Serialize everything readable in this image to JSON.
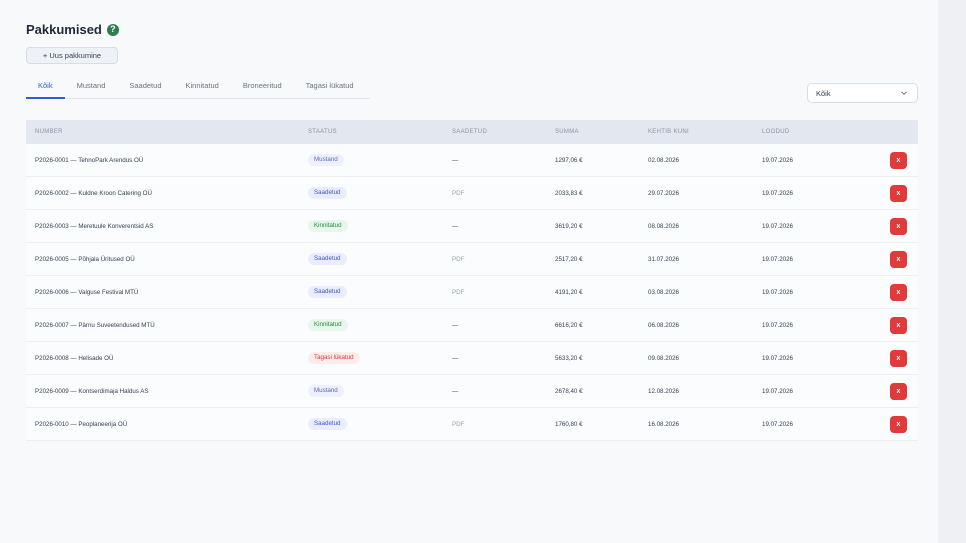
{
  "header": {
    "title": "Pakkumised",
    "help_glyph": "?",
    "new_button_label": "+ Uus pakkumine"
  },
  "tabs": [
    {
      "label": "Kõik",
      "active": true
    },
    {
      "label": "Mustand",
      "active": false
    },
    {
      "label": "Saadetud",
      "active": false
    },
    {
      "label": "Kinnitatud",
      "active": false
    },
    {
      "label": "Broneeritud",
      "active": false
    },
    {
      "label": "Tagasi lükatud",
      "active": false
    }
  ],
  "filter": {
    "selected": "Kõik"
  },
  "table": {
    "columns": [
      "NUMBER",
      "STAATUS",
      "SAADETUD",
      "SUMMA",
      "KEHTIB KUNI",
      "LOODUD"
    ],
    "delete_label": "x",
    "rows": [
      {
        "number": "P2026-0001 — TehnoPark Arendus OÜ",
        "status": "Mustand",
        "status_type": "draft",
        "sent": "—",
        "sum": "1297,06 €",
        "valid_until": "02.08.2026",
        "created": "19.07.2026"
      },
      {
        "number": "P2026-0002 — Kuldne Kroon Catering OÜ",
        "status": "Saadetud",
        "status_type": "sent",
        "sent": "PDF",
        "sum": "2033,83 €",
        "valid_until": "29.07.2026",
        "created": "19.07.2026"
      },
      {
        "number": "P2026-0003 — Meretuule Konverentsid AS",
        "status": "Kinnitatud",
        "status_type": "confirmed",
        "sent": "—",
        "sum": "3619,20 €",
        "valid_until": "08.08.2026",
        "created": "19.07.2026"
      },
      {
        "number": "P2026-0005 — Põhjala Üritused OÜ",
        "status": "Saadetud",
        "status_type": "sent",
        "sent": "PDF",
        "sum": "2517,20 €",
        "valid_until": "31.07.2026",
        "created": "19.07.2026"
      },
      {
        "number": "P2026-0006 — Valguse Festival MTÜ",
        "status": "Saadetud",
        "status_type": "sent",
        "sent": "PDF",
        "sum": "4191,20 €",
        "valid_until": "03.08.2026",
        "created": "19.07.2026"
      },
      {
        "number": "P2026-0007 — Pärnu Suveetendused MTÜ",
        "status": "Kinnitatud",
        "status_type": "confirmed",
        "sent": "—",
        "sum": "6616,20 €",
        "valid_until": "06.08.2026",
        "created": "19.07.2026"
      },
      {
        "number": "P2026-0008 — Helisade OÜ",
        "status": "Tagasi lükatud",
        "status_type": "rejected",
        "sent": "—",
        "sum": "5633,20 €",
        "valid_until": "09.08.2026",
        "created": "19.07.2026"
      },
      {
        "number": "P2026-0009 — Kontserdimaja Haldus AS",
        "status": "Mustand",
        "status_type": "draft",
        "sent": "—",
        "sum": "2678,40 €",
        "valid_until": "12.08.2026",
        "created": "19.07.2026"
      },
      {
        "number": "P2026-0010 — Peoplaneerija OÜ",
        "status": "Saadetud",
        "status_type": "sent",
        "sent": "PDF",
        "sum": "1760,80 €",
        "valid_until": "16.08.2026",
        "created": "19.07.2026"
      }
    ]
  },
  "icons": {
    "help": "help-circle-icon",
    "dropdown": "chevron-down-icon"
  },
  "colors": {
    "accent": "#2f5fd0",
    "help_icon": "#2e7d4f",
    "delete": "#e03a3a"
  }
}
